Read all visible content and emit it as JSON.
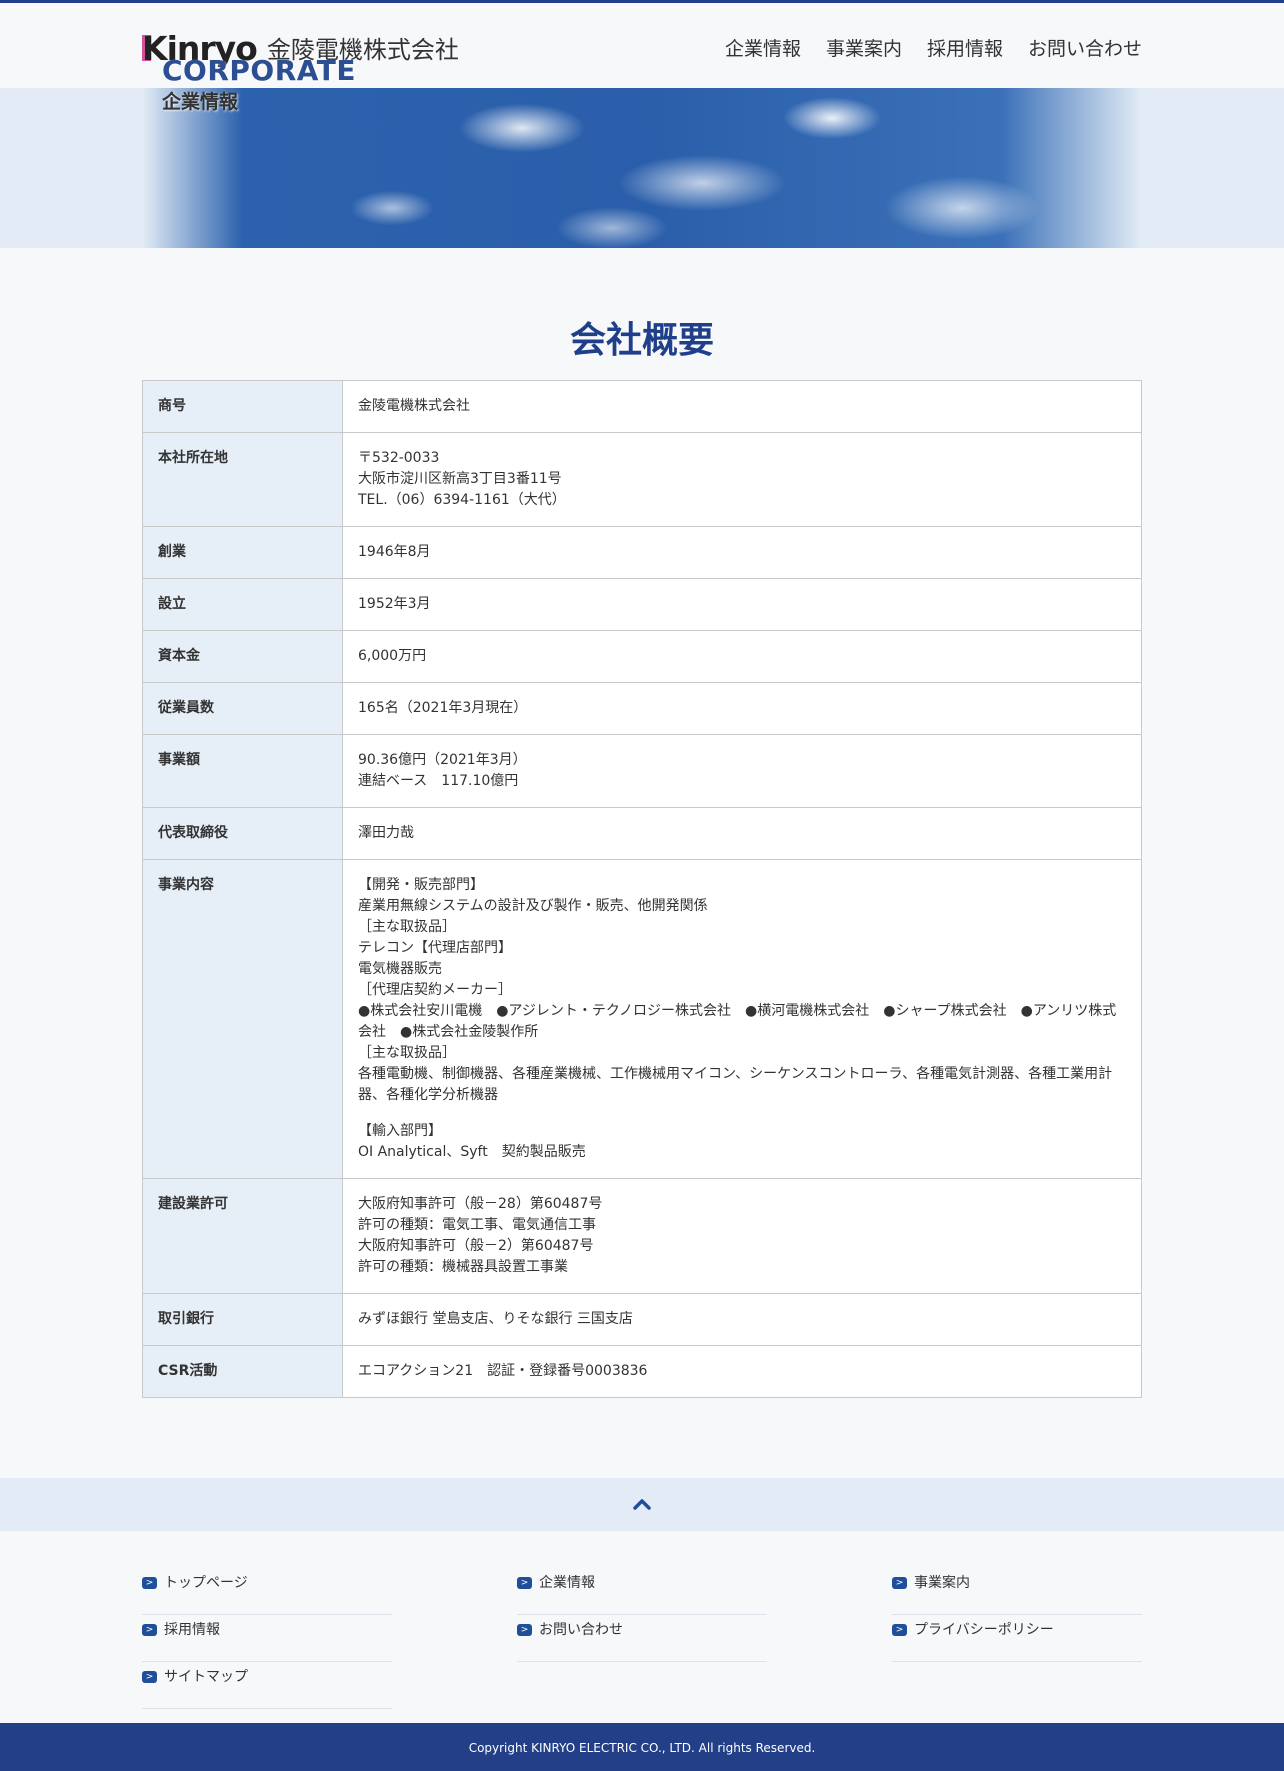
{
  "header": {
    "logo_text": "Kinryo",
    "company_name": "金陵電機株式会社",
    "nav": [
      "企業情報",
      "事業案内",
      "採用情報",
      "お問い合わせ"
    ]
  },
  "hero": {
    "title": "CORPORATE",
    "subtitle": "企業情報"
  },
  "main": {
    "page_title": "会社概要",
    "rows": [
      {
        "label": "商号",
        "lines": [
          "金陵電機株式会社"
        ]
      },
      {
        "label": "本社所在地",
        "lines": [
          "〒532-0033",
          "大阪市淀川区新高3丁目3番11号",
          "TEL.（06）6394-1161（大代）"
        ]
      },
      {
        "label": "創業",
        "lines": [
          "1946年8月"
        ]
      },
      {
        "label": "設立",
        "lines": [
          "1952年3月"
        ]
      },
      {
        "label": "資本金",
        "lines": [
          "6,000万円"
        ]
      },
      {
        "label": "従業員数",
        "lines": [
          "165名（2021年3月現在）"
        ]
      },
      {
        "label": "事業額",
        "lines": [
          "90.36億円（2021年3月）",
          "連結ベース　117.10億円"
        ]
      },
      {
        "label": "代表取締役",
        "lines": [
          "澤田力哉"
        ]
      },
      {
        "label": "事業内容",
        "lines": [
          "【開発・販売部門】",
          "産業用無線システムの設計及び製作・販売、他開発関係",
          "［主な取扱品］",
          "テレコン【代理店部門】",
          "電気機器販売",
          "［代理店契約メーカー］",
          "●株式会社安川電機　●アジレント・テクノロジー株式会社　●横河電機株式会社　●シャープ株式会社　●アンリツ株式会社　●株式会社金陵製作所",
          "［主な取扱品］",
          "各種電動機、制御機器、各種産業機械、工作機械用マイコン、シーケンスコントローラ、各種電気計測器、各種工業用計器、各種化学分析機器",
          "",
          "【輸入部門】",
          "OI Analytical、Syft　契約製品販売"
        ]
      },
      {
        "label": "建設業許可",
        "lines": [
          "大阪府知事許可（般－28）第60487号",
          "許可の種類：電気工事、電気通信工事",
          "大阪府知事許可（般－2）第60487号",
          "許可の種類：機械器具設置工事業"
        ]
      },
      {
        "label": "取引銀行",
        "lines": [
          "みずほ銀行 堂島支店、りそな銀行 三国支店"
        ]
      },
      {
        "label": "CSR活動",
        "lines": [
          "エコアクション21　認証・登録番号0003836"
        ]
      }
    ]
  },
  "footer": {
    "back_to_top_icon": "chevron-up-icon",
    "links": [
      "トップページ",
      "企業情報",
      "事業案内",
      "採用情報",
      "お問い合わせ",
      "プライバシーポリシー",
      "サイトマップ"
    ],
    "copyright": "Copyright KINRYO ELECTRIC CO., LTD. All rights Reserved."
  },
  "colors": {
    "brand_navy": "#1f3f8a",
    "logo_pink": "#d44f9c",
    "table_header_bg": "#e6eef7",
    "footer_bg": "#233f87"
  }
}
